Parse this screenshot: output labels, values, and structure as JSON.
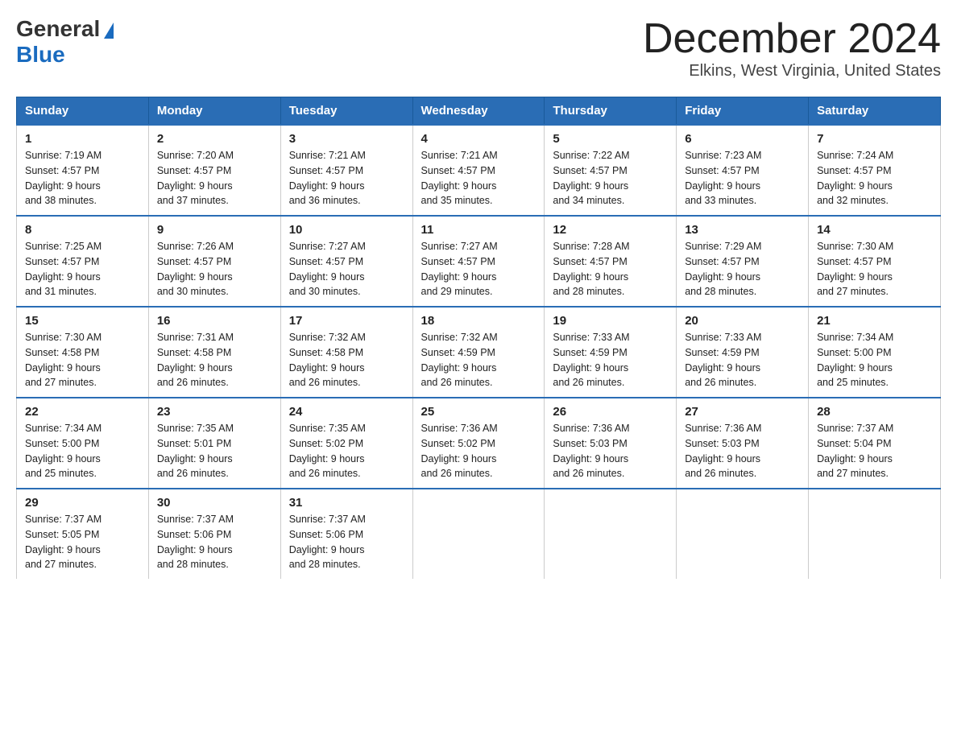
{
  "logo": {
    "general": "General",
    "triangle": "▶",
    "blue": "Blue"
  },
  "title": "December 2024",
  "location": "Elkins, West Virginia, United States",
  "weekdays": [
    "Sunday",
    "Monday",
    "Tuesday",
    "Wednesday",
    "Thursday",
    "Friday",
    "Saturday"
  ],
  "weeks": [
    [
      {
        "day": "1",
        "sunrise": "7:19 AM",
        "sunset": "4:57 PM",
        "daylight": "9 hours and 38 minutes."
      },
      {
        "day": "2",
        "sunrise": "7:20 AM",
        "sunset": "4:57 PM",
        "daylight": "9 hours and 37 minutes."
      },
      {
        "day": "3",
        "sunrise": "7:21 AM",
        "sunset": "4:57 PM",
        "daylight": "9 hours and 36 minutes."
      },
      {
        "day": "4",
        "sunrise": "7:21 AM",
        "sunset": "4:57 PM",
        "daylight": "9 hours and 35 minutes."
      },
      {
        "day": "5",
        "sunrise": "7:22 AM",
        "sunset": "4:57 PM",
        "daylight": "9 hours and 34 minutes."
      },
      {
        "day": "6",
        "sunrise": "7:23 AM",
        "sunset": "4:57 PM",
        "daylight": "9 hours and 33 minutes."
      },
      {
        "day": "7",
        "sunrise": "7:24 AM",
        "sunset": "4:57 PM",
        "daylight": "9 hours and 32 minutes."
      }
    ],
    [
      {
        "day": "8",
        "sunrise": "7:25 AM",
        "sunset": "4:57 PM",
        "daylight": "9 hours and 31 minutes."
      },
      {
        "day": "9",
        "sunrise": "7:26 AM",
        "sunset": "4:57 PM",
        "daylight": "9 hours and 30 minutes."
      },
      {
        "day": "10",
        "sunrise": "7:27 AM",
        "sunset": "4:57 PM",
        "daylight": "9 hours and 30 minutes."
      },
      {
        "day": "11",
        "sunrise": "7:27 AM",
        "sunset": "4:57 PM",
        "daylight": "9 hours and 29 minutes."
      },
      {
        "day": "12",
        "sunrise": "7:28 AM",
        "sunset": "4:57 PM",
        "daylight": "9 hours and 28 minutes."
      },
      {
        "day": "13",
        "sunrise": "7:29 AM",
        "sunset": "4:57 PM",
        "daylight": "9 hours and 28 minutes."
      },
      {
        "day": "14",
        "sunrise": "7:30 AM",
        "sunset": "4:57 PM",
        "daylight": "9 hours and 27 minutes."
      }
    ],
    [
      {
        "day": "15",
        "sunrise": "7:30 AM",
        "sunset": "4:58 PM",
        "daylight": "9 hours and 27 minutes."
      },
      {
        "day": "16",
        "sunrise": "7:31 AM",
        "sunset": "4:58 PM",
        "daylight": "9 hours and 26 minutes."
      },
      {
        "day": "17",
        "sunrise": "7:32 AM",
        "sunset": "4:58 PM",
        "daylight": "9 hours and 26 minutes."
      },
      {
        "day": "18",
        "sunrise": "7:32 AM",
        "sunset": "4:59 PM",
        "daylight": "9 hours and 26 minutes."
      },
      {
        "day": "19",
        "sunrise": "7:33 AM",
        "sunset": "4:59 PM",
        "daylight": "9 hours and 26 minutes."
      },
      {
        "day": "20",
        "sunrise": "7:33 AM",
        "sunset": "4:59 PM",
        "daylight": "9 hours and 26 minutes."
      },
      {
        "day": "21",
        "sunrise": "7:34 AM",
        "sunset": "5:00 PM",
        "daylight": "9 hours and 25 minutes."
      }
    ],
    [
      {
        "day": "22",
        "sunrise": "7:34 AM",
        "sunset": "5:00 PM",
        "daylight": "9 hours and 25 minutes."
      },
      {
        "day": "23",
        "sunrise": "7:35 AM",
        "sunset": "5:01 PM",
        "daylight": "9 hours and 26 minutes."
      },
      {
        "day": "24",
        "sunrise": "7:35 AM",
        "sunset": "5:02 PM",
        "daylight": "9 hours and 26 minutes."
      },
      {
        "day": "25",
        "sunrise": "7:36 AM",
        "sunset": "5:02 PM",
        "daylight": "9 hours and 26 minutes."
      },
      {
        "day": "26",
        "sunrise": "7:36 AM",
        "sunset": "5:03 PM",
        "daylight": "9 hours and 26 minutes."
      },
      {
        "day": "27",
        "sunrise": "7:36 AM",
        "sunset": "5:03 PM",
        "daylight": "9 hours and 26 minutes."
      },
      {
        "day": "28",
        "sunrise": "7:37 AM",
        "sunset": "5:04 PM",
        "daylight": "9 hours and 27 minutes."
      }
    ],
    [
      {
        "day": "29",
        "sunrise": "7:37 AM",
        "sunset": "5:05 PM",
        "daylight": "9 hours and 27 minutes."
      },
      {
        "day": "30",
        "sunrise": "7:37 AM",
        "sunset": "5:06 PM",
        "daylight": "9 hours and 28 minutes."
      },
      {
        "day": "31",
        "sunrise": "7:37 AM",
        "sunset": "5:06 PM",
        "daylight": "9 hours and 28 minutes."
      },
      null,
      null,
      null,
      null
    ]
  ],
  "labels": {
    "sunrise": "Sunrise: ",
    "sunset": "Sunset: ",
    "daylight": "Daylight: "
  }
}
